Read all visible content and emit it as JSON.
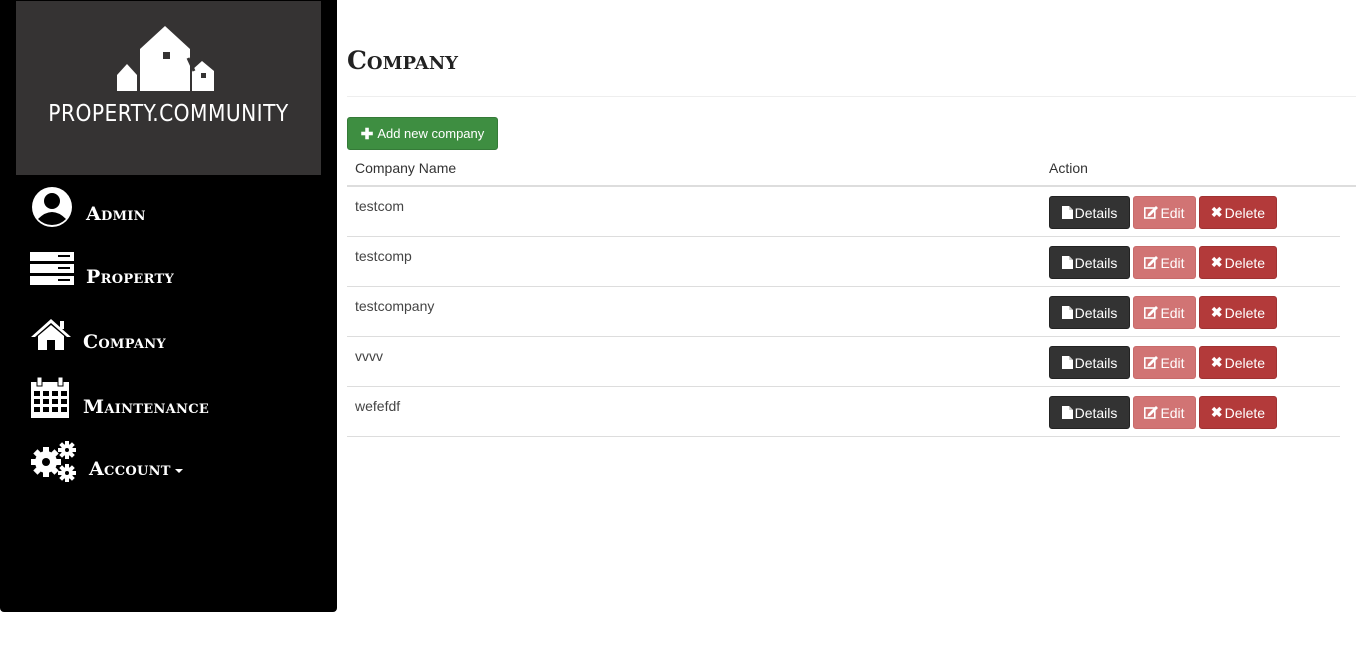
{
  "brand": {
    "name": "PROPERTY.COMMUNITY"
  },
  "sidebar": {
    "items": [
      {
        "label": "Admin",
        "icon": "user-circle-icon"
      },
      {
        "label": "Property",
        "icon": "server-stack-icon"
      },
      {
        "label": "Company",
        "icon": "home-icon"
      },
      {
        "label": "Maintenance",
        "icon": "calendar-icon"
      },
      {
        "label": "Account",
        "icon": "gears-icon"
      }
    ]
  },
  "page": {
    "title": "Company",
    "add_button": "Add new company"
  },
  "table": {
    "columns": [
      "Company Name",
      "Action"
    ],
    "actions": {
      "details": "Details",
      "edit": "Edit",
      "delete": "Delete"
    },
    "rows": [
      {
        "name": "testcom"
      },
      {
        "name": "testcomp"
      },
      {
        "name": "testcompany"
      },
      {
        "name": "vvvv"
      },
      {
        "name": "wefefdf"
      }
    ]
  },
  "colors": {
    "sidebar_bg": "#000000",
    "logo_bg": "#353333",
    "add_green": "#3e8e41",
    "details_dark": "#333333",
    "edit_pink": "#d17474",
    "delete_red": "#b33a3a"
  }
}
